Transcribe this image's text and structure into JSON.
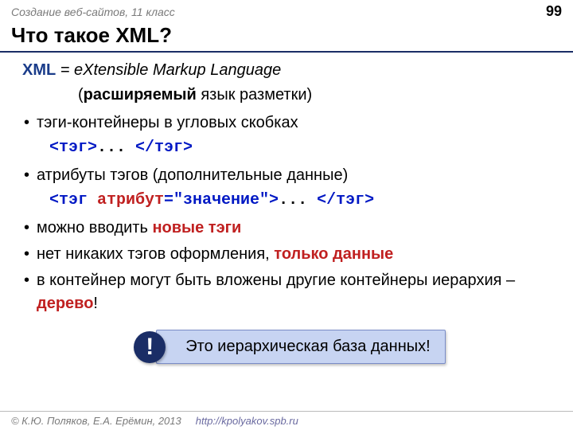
{
  "header": {
    "breadcrumb": "Создание веб-сайтов, 11 класс",
    "page_number": "99"
  },
  "title": "Что такое XML?",
  "def": {
    "abbr": "XML",
    "eq": " = ",
    "expansion": "eXtensible Markup Language",
    "sub_open": "(",
    "sub_bold": "расширяемый",
    "sub_rest": " язык разметки)"
  },
  "bullets": {
    "b1": "тэги-контейнеры в угловых скобках",
    "code1": {
      "open": "<тэг>",
      "dots": "... ",
      "close": "</тэг>"
    },
    "b2": "атрибуты тэгов (дополнительные данные)",
    "code2": {
      "p1": "<тэг ",
      "attr": "атрибут",
      "p2": "=\"значение\">",
      "dots": "... ",
      "close": "</тэг>"
    },
    "b3a": "можно вводить ",
    "b3b": "новые тэги",
    "b4a": "нет никаких тэгов оформления, ",
    "b4b": "только данные",
    "b5a": "в контейнер могут быть вложены другие контейнеры иерархия – ",
    "b5b": "дерево",
    "b5c": "!"
  },
  "callout": {
    "icon": "!",
    "text": "Это иерархическая база данных!"
  },
  "footer": {
    "copyright": "© К.Ю. Поляков, Е.А. Ерёмин, 2013",
    "url": "http://kpolyakov.spb.ru"
  }
}
